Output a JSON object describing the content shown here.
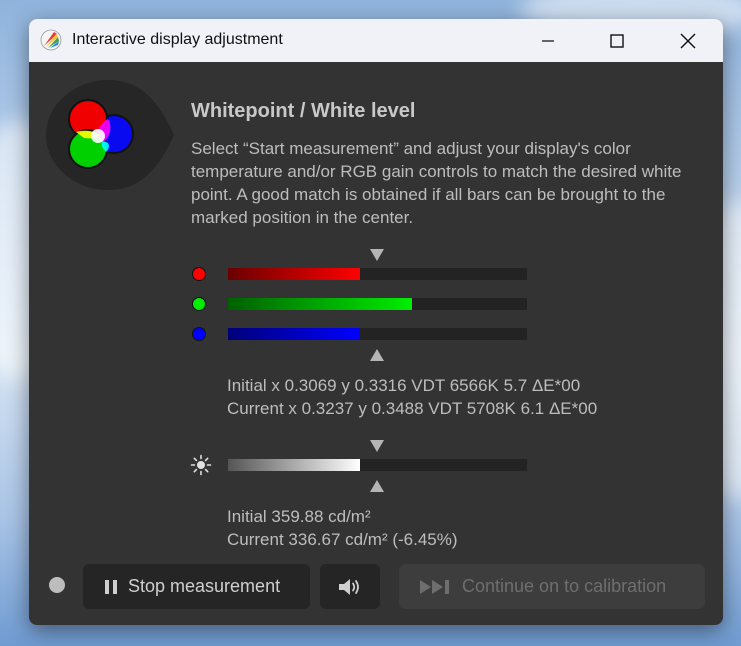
{
  "window": {
    "title": "Interactive display adjustment"
  },
  "main": {
    "heading": "Whitepoint / White level",
    "description": "Select “Start measurement” and adjust your display's color temperature and/or RGB gain controls to match the desired white point. A good match is obtained if all bars can be brought to the marked position in the center."
  },
  "rgb_bars": [
    {
      "channel": "red",
      "color": "#ff0000",
      "fill_fraction": 0.44
    },
    {
      "channel": "green",
      "color": "#00dd00",
      "fill_fraction": 0.615
    },
    {
      "channel": "blue",
      "color": "#0000ff",
      "fill_fraction": 0.44
    }
  ],
  "readout": {
    "initial": "Initial x 0.3069 y 0.3316 VDT 6566K 5.7 ΔE*00",
    "current": "Current x 0.3237 y 0.3488 VDT 5708K 6.1 ΔE*00"
  },
  "luminance_bar": {
    "icon": "sun-icon",
    "fill_fraction": 0.44
  },
  "luminance": {
    "initial": "Initial 359.88 cd/m²",
    "current": "Current 336.67 cd/m² (-6.45%)"
  },
  "buttons": {
    "stop": "Stop measurement",
    "continue": "Continue on to calibration"
  },
  "icons": {
    "pause": "pause-icon",
    "sound": "speaker-icon",
    "skip": "skip-forward-icon"
  }
}
